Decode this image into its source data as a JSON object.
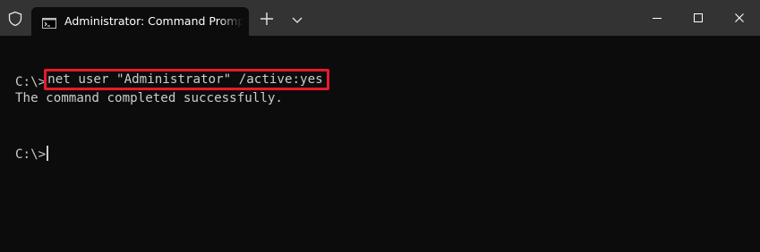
{
  "tab": {
    "title": "Administrator: Command Prompt"
  },
  "terminal": {
    "lines": [
      {
        "prompt": "C:\\>",
        "command": "net user \"Administrator\" /active:yes"
      },
      {
        "output": "The command completed successfully."
      },
      {
        "prompt": "C:\\>"
      }
    ]
  },
  "colors": {
    "titlebar_bg": "#333333",
    "terminal_bg": "#0c0c0c",
    "text": "#cccccc",
    "highlight_border": "#e8192c"
  },
  "icons": {
    "shield": "shield-icon",
    "tab": "cmd-icon",
    "new_tab": "plus-icon",
    "dropdown": "chevron-down-icon",
    "minimize": "minimize-icon",
    "maximize": "maximize-icon",
    "close": "close-icon"
  }
}
